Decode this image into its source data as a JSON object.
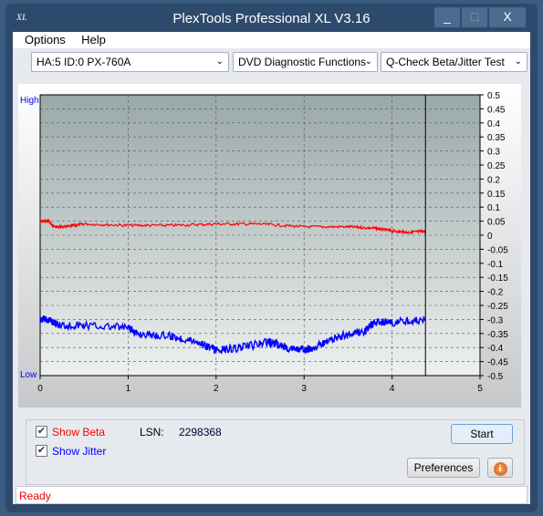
{
  "window": {
    "title": "PlexTools Professional XL V3.16",
    "logo": "XL",
    "minimize": "_",
    "maximize": "□",
    "close": "X"
  },
  "menu": [
    "Options",
    "Help"
  ],
  "toolbar": {
    "drive": "HA:5 ID:0  PX-760A",
    "function": "DVD Diagnostic Functions",
    "test": "Q-Check Beta/Jitter Test"
  },
  "chart_data": {
    "type": "line",
    "xlim": [
      0,
      5
    ],
    "ylim": [
      -0.5,
      0.5
    ],
    "x_ticks": [
      "0",
      "1",
      "2",
      "3",
      "4",
      "5"
    ],
    "y_ticks": [
      "0.5",
      "0.45",
      "0.4",
      "0.35",
      "0.3",
      "0.25",
      "0.2",
      "0.15",
      "0.1",
      "0.05",
      "0",
      "-0.05",
      "-0.1",
      "-0.15",
      "-0.2",
      "-0.25",
      "-0.3",
      "-0.35",
      "-0.4",
      "-0.45",
      "-0.5"
    ],
    "left_labels": {
      "top": "High",
      "bottom": "Low"
    },
    "grid": true,
    "marker_x": 4.38,
    "series": [
      {
        "color": "#ff0000",
        "x": [
          0,
          0.1,
          0.15,
          0.3,
          0.5,
          1,
          1.5,
          2,
          2.5,
          3,
          3.5,
          3.8,
          4,
          4.2,
          4.38
        ],
        "y": [
          0.05,
          0.05,
          0.03,
          0.03,
          0.04,
          0.035,
          0.035,
          0.04,
          0.04,
          0.03,
          0.03,
          0.025,
          0.015,
          0.01,
          0.015
        ]
      },
      {
        "color": "#0000ff",
        "x": [
          0,
          0.1,
          0.2,
          0.5,
          1,
          1.1,
          1.5,
          1.8,
          2,
          2.3,
          2.6,
          2.8,
          3,
          3.2,
          3.4,
          3.7,
          3.8,
          4,
          4.38
        ],
        "y": [
          -0.3,
          -0.3,
          -0.32,
          -0.32,
          -0.33,
          -0.35,
          -0.36,
          -0.38,
          -0.41,
          -0.4,
          -0.38,
          -0.4,
          -0.41,
          -0.39,
          -0.36,
          -0.34,
          -0.31,
          -0.31,
          -0.3
        ]
      }
    ]
  },
  "controls": {
    "show_beta": "Show Beta",
    "show_jitter": "Show Jitter",
    "lsn_label": "LSN:",
    "lsn_value": "2298368",
    "start": "Start",
    "preferences": "Preferences",
    "beta_color": "#ff0000",
    "jitter_color": "#0000ff"
  },
  "status": "Ready"
}
